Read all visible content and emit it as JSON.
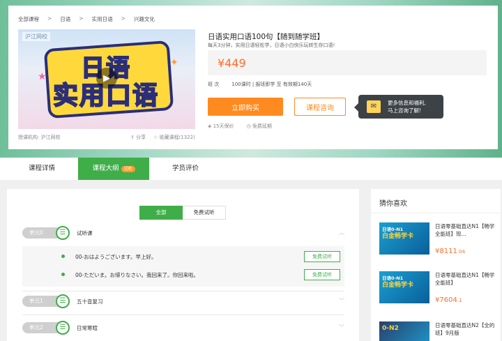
{
  "breadcrumb": [
    "全部课程",
    "日语",
    "实用日语",
    "兴趣文化"
  ],
  "breadcrumb_sep": ">",
  "cover": {
    "logo": "沪江网校",
    "title_line1": "日语",
    "title_line2": "实用口语"
  },
  "teacher": "授课机构: 沪江网校",
  "share": "分享",
  "collect": "收藏课程(1322)",
  "course": {
    "title": "日语实用口语100句【随到随学班】",
    "subtitle": "每天3分钟，实用日语轻松学，日语小白快乐玩转生存口语!",
    "price": "¥449",
    "meta_label": "班  次",
    "meta_value": "100课时 | 报班即学 至 有效期140天"
  },
  "buttons": {
    "buy": "立即购买",
    "consult": "课程咨询"
  },
  "tip": {
    "line1": "更多信息和福利,",
    "line2": "马上咨询了解!"
  },
  "guarantees": [
    "15天保价",
    "免费延期"
  ],
  "tabs": [
    {
      "label": "课程详情"
    },
    {
      "label": "课程大纲",
      "badge": "试听"
    },
    {
      "label": "学员评价"
    }
  ],
  "filter": [
    "全部",
    "免费试听"
  ],
  "units": [
    {
      "pill": "单元0",
      "name": "试听课"
    },
    {
      "pill": "单元1",
      "name": "五十音复习"
    },
    {
      "pill": "单元2",
      "name": "日常寒暄"
    }
  ],
  "lessons": [
    {
      "text": "00-おはようございます。早上好。",
      "trial": "免费试听"
    },
    {
      "text": "00-ただいま。お帰りなさい。我回来了。你回来啦。",
      "trial": "免费试听"
    }
  ],
  "side": {
    "title": "猜你喜欢",
    "items": [
      {
        "thumb_a": "日语0-N1",
        "thumb_b": "白金畅学卡",
        "title": "日语零基础直达N1【畅学全能班】现...",
        "price_main": "¥8111",
        "price_dec": ".04"
      },
      {
        "thumb_a": "日语0-N1",
        "thumb_b": "白金畅学卡",
        "title": "日语零基础直达N1【畅学全能班】",
        "price_main": "¥7604",
        "price_dec": ".1"
      },
      {
        "thumb_a": "0-N2",
        "thumb_b": "",
        "title": "日语零基础直达N2【全的班】9月版",
        "price_main": "",
        "price_dec": ""
      }
    ]
  },
  "colors": {
    "green": "#3fae49",
    "orange": "#ff8a1f",
    "price": "#ff6d2d"
  }
}
